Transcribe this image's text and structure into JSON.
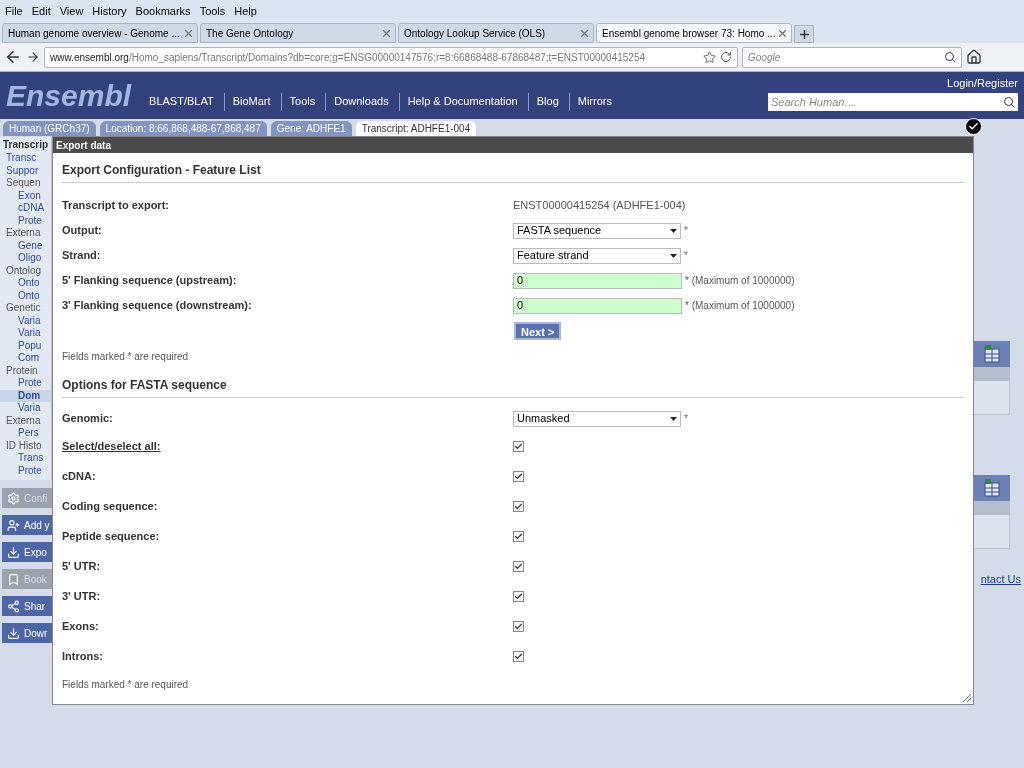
{
  "menu_bar": [
    "File",
    "Edit",
    "View",
    "History",
    "Bookmarks",
    "Tools",
    "Help"
  ],
  "browser_tabs": [
    {
      "title": "Human genome overview - Genome ...",
      "selected": false
    },
    {
      "title": "The Gene Ontology",
      "selected": false
    },
    {
      "title": "Ontology Lookup Service (OLS)",
      "selected": false
    },
    {
      "title": "Ensembl genome browser 73: Homo ...",
      "selected": true
    }
  ],
  "address_bar": {
    "domain": "www.ensembl.org",
    "path": "/Homo_sapiens/Transcript/Domains?db=core;g=ENSG00000147576;r=8:66868488-67868487;t=ENST00000415254"
  },
  "web_search": {
    "placeholder": "Google"
  },
  "site_header": {
    "logo": "Ensembl",
    "nav": [
      "BLAST/BLAT",
      "BioMart",
      "Tools",
      "Downloads",
      "Help & Documentation",
      "Blog",
      "Mirrors"
    ],
    "login": "Login/Register",
    "search": {
      "placeholder": "Search Human…"
    }
  },
  "breadcrumbs": [
    {
      "label": "Human (GRCh37)",
      "selected": false
    },
    {
      "label": "Location: 8:66,868,488-67,868,487",
      "selected": false
    },
    {
      "label": "Gene: ADHFE1",
      "selected": false
    },
    {
      "label": "Transcript: ADHFE1-004",
      "selected": true
    }
  ],
  "sidebar": {
    "title": "Transcrip",
    "items": [
      {
        "label": "Transc",
        "selected": false
      },
      {
        "label": "Suppor",
        "selected": false
      },
      {
        "label": "Sequen",
        "selected": false,
        "children": [
          {
            "label": "Exon",
            "selected": false
          },
          {
            "label": "cDNA",
            "selected": false
          },
          {
            "label": "Prote",
            "selected": false
          }
        ]
      },
      {
        "label": "Externa",
        "selected": false,
        "children": [
          {
            "label": "Gene",
            "selected": false
          },
          {
            "label": "Oligo",
            "selected": false
          }
        ]
      },
      {
        "label": "Ontolog",
        "selected": false,
        "children": [
          {
            "label": "Onto",
            "selected": false
          },
          {
            "label": "Onto",
            "selected": false
          }
        ]
      },
      {
        "label": "Genetic",
        "selected": false,
        "children": [
          {
            "label": "Varia",
            "selected": false
          },
          {
            "label": "Varia",
            "selected": false
          },
          {
            "label": "Popu",
            "selected": false
          },
          {
            "label": "Com",
            "selected": false
          }
        ]
      },
      {
        "label": "Protein",
        "selected": false,
        "children": [
          {
            "label": "Prote",
            "selected": false
          },
          {
            "label": "Dom",
            "selected": true
          },
          {
            "label": "Varia",
            "selected": false
          }
        ]
      },
      {
        "label": "Externa",
        "selected": false,
        "children": [
          {
            "label": "Pers",
            "selected": false
          }
        ]
      },
      {
        "label": "ID Histo",
        "selected": false,
        "children": [
          {
            "label": "Trans",
            "selected": false
          },
          {
            "label": "Prote",
            "selected": false
          }
        ]
      }
    ],
    "buttons": [
      {
        "label": "Confi",
        "kind": "gear",
        "disabled": true
      },
      {
        "label": "Add y",
        "kind": "add",
        "disabled": false
      },
      {
        "label": "Expo",
        "kind": "export",
        "disabled": false
      },
      {
        "label": "Book",
        "kind": "bookmark",
        "disabled": true
      },
      {
        "label": "Shar",
        "kind": "share",
        "disabled": false
      },
      {
        "label": "Dowr",
        "kind": "export",
        "disabled": false
      }
    ]
  },
  "contact_link": "ntact Us",
  "dialog": {
    "title": "Export data",
    "section1": {
      "heading": "Export Configuration - Feature List",
      "rows": [
        {
          "kind": "text",
          "label": "Transcript to export:",
          "value": "ENST00000415254 (ADHFE1-004)"
        },
        {
          "kind": "select",
          "label": "Output:",
          "value": "FASTA sequence",
          "required": "*"
        },
        {
          "kind": "select",
          "label": "Strand:",
          "value": "Feature strand",
          "required": "*"
        },
        {
          "kind": "input",
          "label": "5' Flanking sequence (upstream):",
          "value": "0",
          "required": "* (Maximum of 1000000)"
        },
        {
          "kind": "input",
          "label": "3' Flanking sequence (downstream):",
          "value": "0",
          "required": "* (Maximum of 1000000)"
        }
      ],
      "next_button": "Next >",
      "note": "Fields marked * are required"
    },
    "section2": {
      "heading": "Options for FASTA sequence",
      "rows": [
        {
          "kind": "select",
          "label": "Genomic:",
          "value": "Unmasked",
          "required": "*"
        },
        {
          "kind": "checkbox",
          "label": "Select/deselect all:",
          "checked": true,
          "underlined": true
        },
        {
          "kind": "checkbox",
          "label": "cDNA:",
          "checked": true,
          "underlined": false
        },
        {
          "kind": "checkbox",
          "label": "Coding sequence:",
          "checked": true,
          "underlined": false
        },
        {
          "kind": "checkbox",
          "label": "Peptide sequence:",
          "checked": true,
          "underlined": false
        },
        {
          "kind": "checkbox",
          "label": "5' UTR:",
          "checked": true,
          "underlined": false
        },
        {
          "kind": "checkbox",
          "label": "3' UTR:",
          "checked": true,
          "underlined": false
        },
        {
          "kind": "checkbox",
          "label": "Exons:",
          "checked": true,
          "underlined": false
        },
        {
          "kind": "checkbox",
          "label": "Introns:",
          "checked": true,
          "underlined": false
        }
      ],
      "note": "Fields marked * are required"
    }
  }
}
